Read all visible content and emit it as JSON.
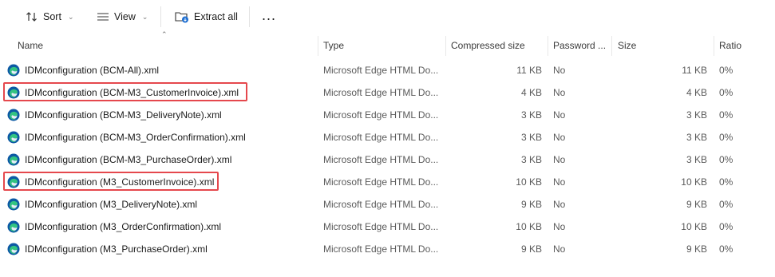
{
  "toolbar": {
    "sort_label": "Sort",
    "view_label": "View",
    "extract_label": "Extract all",
    "more_label": "..."
  },
  "columns": {
    "name": "Name",
    "type": "Type",
    "compressed": "Compressed size",
    "password": "Password ...",
    "size": "Size",
    "ratio": "Ratio"
  },
  "files": [
    {
      "name": "IDMconfiguration (BCM-All).xml",
      "type": "Microsoft Edge HTML Do...",
      "compressed": "11 KB",
      "password": "No",
      "size": "11 KB",
      "ratio": "0%",
      "highlighted": false
    },
    {
      "name": "IDMconfiguration (BCM-M3_CustomerInvoice).xml",
      "type": "Microsoft Edge HTML Do...",
      "compressed": "4 KB",
      "password": "No",
      "size": "4 KB",
      "ratio": "0%",
      "highlighted": true
    },
    {
      "name": "IDMconfiguration (BCM-M3_DeliveryNote).xml",
      "type": "Microsoft Edge HTML Do...",
      "compressed": "3 KB",
      "password": "No",
      "size": "3 KB",
      "ratio": "0%",
      "highlighted": false
    },
    {
      "name": "IDMconfiguration (BCM-M3_OrderConfirmation).xml",
      "type": "Microsoft Edge HTML Do...",
      "compressed": "3 KB",
      "password": "No",
      "size": "3 KB",
      "ratio": "0%",
      "highlighted": false
    },
    {
      "name": "IDMconfiguration (BCM-M3_PurchaseOrder).xml",
      "type": "Microsoft Edge HTML Do...",
      "compressed": "3 KB",
      "password": "No",
      "size": "3 KB",
      "ratio": "0%",
      "highlighted": false
    },
    {
      "name": "IDMconfiguration (M3_CustomerInvoice).xml",
      "type": "Microsoft Edge HTML Do...",
      "compressed": "10 KB",
      "password": "No",
      "size": "10 KB",
      "ratio": "0%",
      "highlighted": true
    },
    {
      "name": "IDMconfiguration (M3_DeliveryNote).xml",
      "type": "Microsoft Edge HTML Do...",
      "compressed": "9 KB",
      "password": "No",
      "size": "9 KB",
      "ratio": "0%",
      "highlighted": false
    },
    {
      "name": "IDMconfiguration (M3_OrderConfirmation).xml",
      "type": "Microsoft Edge HTML Do...",
      "compressed": "10 KB",
      "password": "No",
      "size": "10 KB",
      "ratio": "0%",
      "highlighted": false
    },
    {
      "name": "IDMconfiguration (M3_PurchaseOrder).xml",
      "type": "Microsoft Edge HTML Do...",
      "compressed": "9 KB",
      "password": "No",
      "size": "9 KB",
      "ratio": "0%",
      "highlighted": false
    }
  ],
  "icons": {
    "sort": "sort-icon",
    "view": "view-list-icon",
    "extract": "extract-folder-icon",
    "file": "edge-browser-icon"
  },
  "colors": {
    "highlight_border": "#e5484d",
    "edge_blue": "#0c59a4",
    "edge_teal": "#33c481"
  }
}
